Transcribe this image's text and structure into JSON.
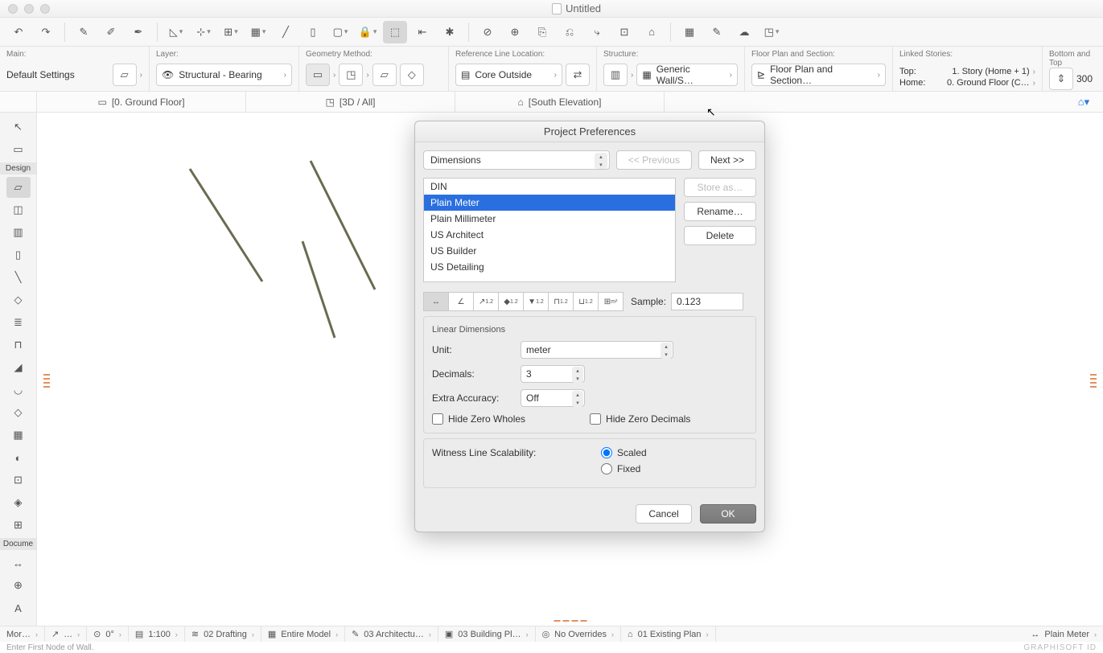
{
  "window": {
    "title": "Untitled"
  },
  "infobox": {
    "main": {
      "label": "Main:",
      "default": "Default Settings"
    },
    "layer": {
      "label": "Layer:",
      "value": "Structural - Bearing"
    },
    "geometry": {
      "label": "Geometry Method:"
    },
    "refline": {
      "label": "Reference Line Location:",
      "value": "Core Outside"
    },
    "structure": {
      "label": "Structure:",
      "value": "Generic Wall/S…"
    },
    "floorplan": {
      "label": "Floor Plan and Section:",
      "value": "Floor Plan and Section…"
    },
    "linked": {
      "label": "Linked Stories:",
      "top_label": "Top:",
      "top_value": "1. Story (Home + 1)",
      "home_label": "Home:",
      "home_value": "0. Ground Floor (C…"
    },
    "bottom": {
      "label": "Bottom and Top",
      "value": "300"
    }
  },
  "tabs": {
    "t0": "[0. Ground Floor]",
    "t1": "[3D / All]",
    "t2": "[South Elevation]"
  },
  "tool_sections": {
    "design": "Design",
    "docume": "Docume"
  },
  "dialog": {
    "title": "Project Preferences",
    "category": "Dimensions",
    "prev": "<< Previous",
    "next": "Next >>",
    "standards": {
      "s0": "DIN",
      "s1": "Plain Meter",
      "s2": "Plain Millimeter",
      "s3": "US Architect",
      "s4": "US Builder",
      "s5": "US Detailing"
    },
    "store": "Store as…",
    "rename": "Rename…",
    "delete": "Delete",
    "sample_label": "Sample:",
    "sample_value": "0.123",
    "linear_title": "Linear Dimensions",
    "unit_label": "Unit:",
    "unit_value": "meter",
    "decimals_label": "Decimals:",
    "decimals_value": "3",
    "extra_label": "Extra Accuracy:",
    "extra_value": "Off",
    "hide_wholes": "Hide Zero Wholes",
    "hide_decimals": "Hide Zero Decimals",
    "witness_label": "Witness Line Scalability:",
    "scaled": "Scaled",
    "fixed": "Fixed",
    "cancel": "Cancel",
    "ok": "OK"
  },
  "status": {
    "s0": "Mor…",
    "s1": "…",
    "s2": "0°",
    "s3": "1:100",
    "s4": "02 Drafting",
    "s5": "Entire Model",
    "s6": "03 Architectu…",
    "s7": "03 Building Pl…",
    "s8": "No Overrides",
    "s9": "01 Existing Plan",
    "s10": "Plain Meter"
  },
  "bottom_hint": "Enter First Node of Wall.",
  "branding": "GRAPHISOFT ID"
}
